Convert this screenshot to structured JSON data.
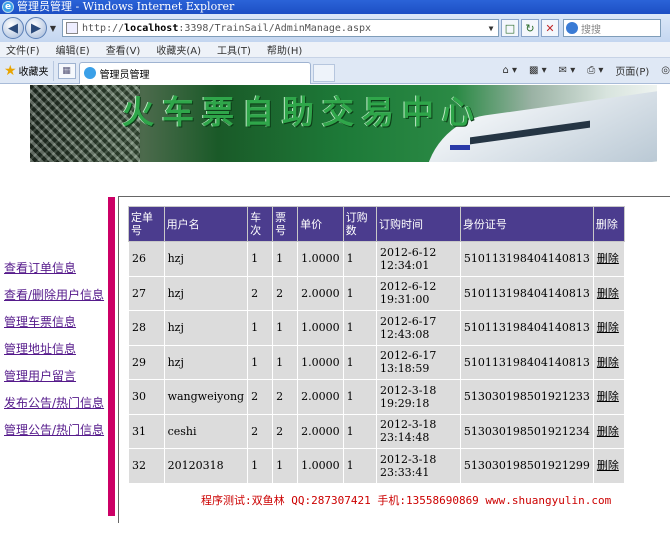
{
  "browser": {
    "window_title": "管理员管理 - Windows Internet Explorer",
    "url_prefix": "http://",
    "url_host": "localhost",
    "url_rest": ":3398/TrainSail/AdminManage.aspx",
    "search_placeholder": "搜搜",
    "menu": [
      "文件(F)",
      "编辑(E)",
      "查看(V)",
      "收藏夹(A)",
      "工具(T)",
      "帮助(H)"
    ],
    "favorites_label": "收藏夹",
    "tab_label": "管理员管理",
    "page_menu": "页面(P)",
    "tools_menu": "◎"
  },
  "banner": {
    "title": "火车票自助交易中心"
  },
  "sidebar": {
    "items": [
      "查看订单信息",
      "查看/删除用户信息",
      "管理车票信息",
      "管理地址信息",
      "管理用户留言",
      "发布公告/热门信息",
      "管理公告/热门信息"
    ]
  },
  "table": {
    "headers": [
      "定单号",
      "用户名",
      "车次",
      "票号",
      "单价",
      "订购数",
      "订购时间",
      "身份证号",
      "删除"
    ],
    "rows": [
      [
        "26",
        "hzj",
        "1",
        "1",
        "1.0000",
        "1",
        "2012-6-12 12:34:01",
        "510113198404140813",
        "删除"
      ],
      [
        "27",
        "hzj",
        "2",
        "2",
        "2.0000",
        "1",
        "2012-6-12 19:31:00",
        "510113198404140813",
        "删除"
      ],
      [
        "28",
        "hzj",
        "1",
        "1",
        "1.0000",
        "1",
        "2012-6-17 12:43:08",
        "510113198404140813",
        "删除"
      ],
      [
        "29",
        "hzj",
        "1",
        "1",
        "1.0000",
        "1",
        "2012-6-17 13:18:59",
        "510113198404140813",
        "删除"
      ],
      [
        "30",
        "wangweiyong",
        "2",
        "2",
        "2.0000",
        "1",
        "2012-3-18 19:29:18",
        "513030198501921233",
        "删除"
      ],
      [
        "31",
        "ceshi",
        "2",
        "2",
        "2.0000",
        "1",
        "2012-3-18 23:14:48",
        "513030198501921234",
        "删除"
      ],
      [
        "32",
        "20120318",
        "1",
        "1",
        "1.0000",
        "1",
        "2012-3-18 23:33:41",
        "513030198501921299",
        "删除"
      ]
    ]
  },
  "footer": {
    "text": "程序测试:双鱼林 QQ:287307421 手机:13558690869 www.shuangyulin.com"
  }
}
